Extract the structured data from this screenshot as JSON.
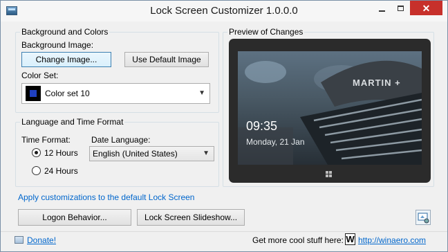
{
  "window": {
    "title": "Lock Screen Customizer 1.0.0.0"
  },
  "titlebar": {
    "minimize": "—",
    "maximize": "□",
    "close": "✕"
  },
  "background_group": {
    "legend": "Background and Colors",
    "bg_label": "Background Image:",
    "change_image": "Change Image...",
    "use_default": "Use Default Image",
    "color_label": "Color Set:",
    "color_value": "Color set 10",
    "color_swatch": "#1f3fbf"
  },
  "language_group": {
    "legend": "Language and Time Format",
    "time_label": "Time Format:",
    "time_12": "12 Hours",
    "time_24": "24 Hours",
    "time_selected": "12 Hours",
    "date_label": "Date Language:",
    "date_value": "English (United States)"
  },
  "preview": {
    "legend": "Preview of Changes",
    "time": "09:35",
    "date": "Monday, 21 Jan",
    "sign_text": "MARTIN +"
  },
  "apply_link": "Apply customizations to the default Lock Screen",
  "buttons": {
    "logon": "Logon Behavior...",
    "slideshow": "Lock Screen Slideshow..."
  },
  "footer": {
    "donate": "Donate!",
    "more_text": "Get more cool stuff here:",
    "winaero_logo": "W",
    "winaero_url": "http://winaero.com"
  },
  "colors": {
    "accent_link": "#0066cc",
    "close_red": "#c7302b"
  }
}
